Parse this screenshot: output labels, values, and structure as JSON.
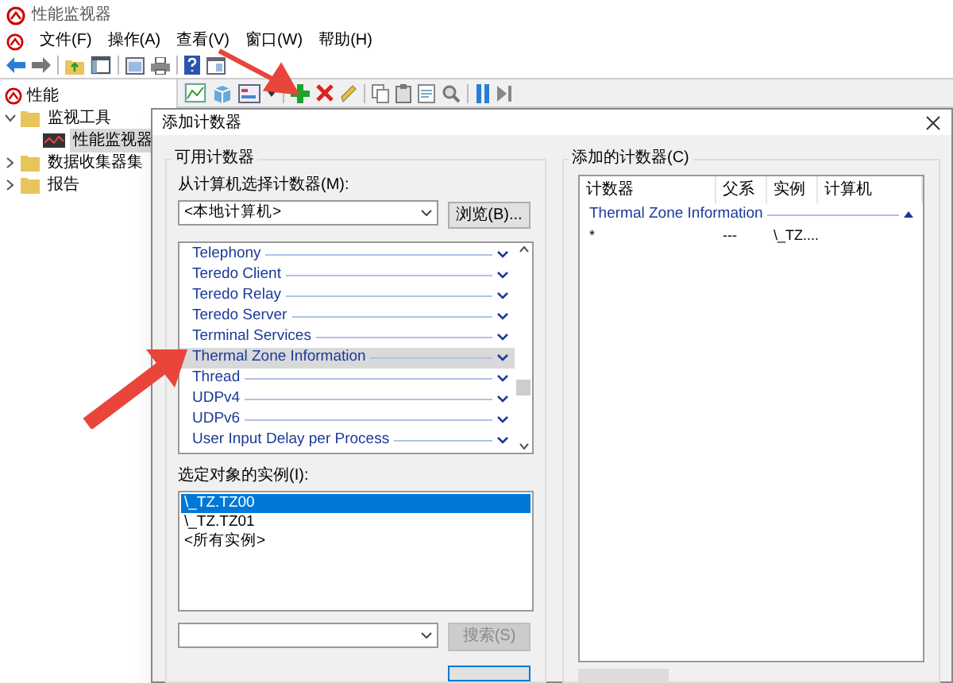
{
  "window": {
    "title": "性能监视器"
  },
  "menu": [
    "文件(F)",
    "操作(A)",
    "查看(V)",
    "窗口(W)",
    "帮助(H)"
  ],
  "tree": {
    "root": "性能",
    "items": [
      {
        "label": "监视工具",
        "expanded": true,
        "selected": false,
        "children": [
          {
            "label": "性能监视器",
            "selected": true
          }
        ]
      },
      {
        "label": "数据收集器集",
        "expanded": false,
        "selected": false
      },
      {
        "label": "报告",
        "expanded": false,
        "selected": false
      }
    ]
  },
  "dialog": {
    "title": "添加计数器",
    "available": {
      "legend": "可用计数器",
      "computer_label": "从计算机选择计数器(M):",
      "computer": "<本地计算机>",
      "browse_button": "浏览(B)...",
      "counters": [
        {
          "label": "Telephony",
          "selected": false
        },
        {
          "label": "Teredo Client",
          "selected": false
        },
        {
          "label": "Teredo Relay",
          "selected": false
        },
        {
          "label": "Teredo Server",
          "selected": false
        },
        {
          "label": "Terminal Services",
          "selected": false
        },
        {
          "label": "Thermal Zone Information",
          "selected": true
        },
        {
          "label": "Thread",
          "selected": false
        },
        {
          "label": "UDPv4",
          "selected": false
        },
        {
          "label": "UDPv6",
          "selected": false
        },
        {
          "label": "User Input Delay per Process",
          "selected": false
        }
      ],
      "instances_label": "选定对象的实例(I):",
      "instances": [
        {
          "label": "\\_TZ.TZ00",
          "selected": true
        },
        {
          "label": "\\_TZ.TZ01",
          "selected": false
        },
        {
          "label": "<所有实例>",
          "selected": false
        }
      ],
      "search_button": {
        "label": "搜索(S)",
        "disabled": true
      }
    },
    "added": {
      "legend": "添加的计数器(C)",
      "columns": [
        "计数器",
        "父系",
        "实例",
        "计算机"
      ],
      "groups": [
        {
          "label": "Thermal Zone Information",
          "expanded": true,
          "rows": [
            {
              "counter": "*",
              "parent": "---",
              "instance": "\\_TZ...."
            }
          ]
        }
      ]
    }
  }
}
